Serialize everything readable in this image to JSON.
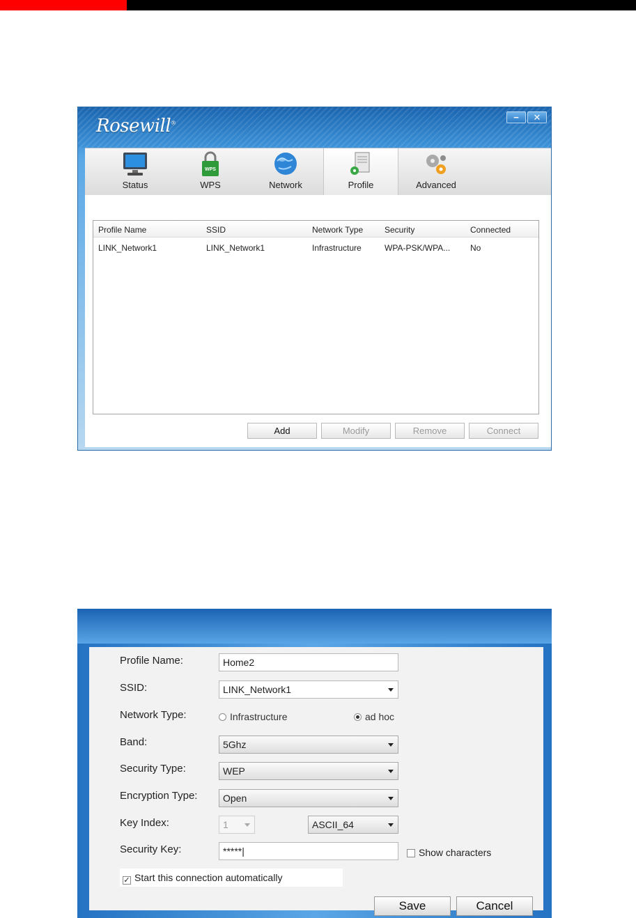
{
  "window1": {
    "logo": "Rosewill",
    "logo_mark": "®",
    "minimize_label": "−",
    "close_label": "✕",
    "tabs": [
      {
        "label": "Status",
        "icon": "monitor-icon"
      },
      {
        "label": "WPS",
        "icon": "wps-lock-icon"
      },
      {
        "label": "Network",
        "icon": "globe-icon"
      },
      {
        "label": "Profile",
        "icon": "profile-icon",
        "active": true
      },
      {
        "label": "Advanced",
        "icon": "gears-icon"
      }
    ],
    "table": {
      "headers": [
        "Profile Name",
        "SSID",
        "Network Type",
        "Security",
        "Connected"
      ],
      "rows": [
        [
          "LINK_Network1",
          "LINK_Network1",
          "Infrastructure",
          "WPA-PSK/WPA...",
          "No"
        ]
      ]
    },
    "buttons": {
      "add": "Add",
      "modify": "Modify",
      "remove": "Remove",
      "connect": "Connect"
    }
  },
  "window2": {
    "labels": {
      "profile_name": "Profile Name:",
      "ssid": "SSID:",
      "network_type": "Network Type:",
      "band": "Band:",
      "security_type": "Security Type:",
      "encryption_type": "Encryption Type:",
      "key_index": "Key Index:",
      "security_key": "Security Key:"
    },
    "values": {
      "profile_name": "Home2",
      "ssid": "LINK_Network1",
      "band": "5Ghz",
      "security_type": "WEP",
      "encryption_type": "Open",
      "key_index": "1",
      "key_format": "ASCII_64",
      "security_key": "*****|"
    },
    "radios": {
      "infrastructure": "Infrastructure",
      "adhoc": "ad hoc",
      "selected": "adhoc"
    },
    "show_characters": "Show characters",
    "auto_connect": "Start this connection automatically",
    "auto_connect_checked": "✓",
    "buttons": {
      "save": "Save",
      "cancel": "Cancel"
    }
  }
}
